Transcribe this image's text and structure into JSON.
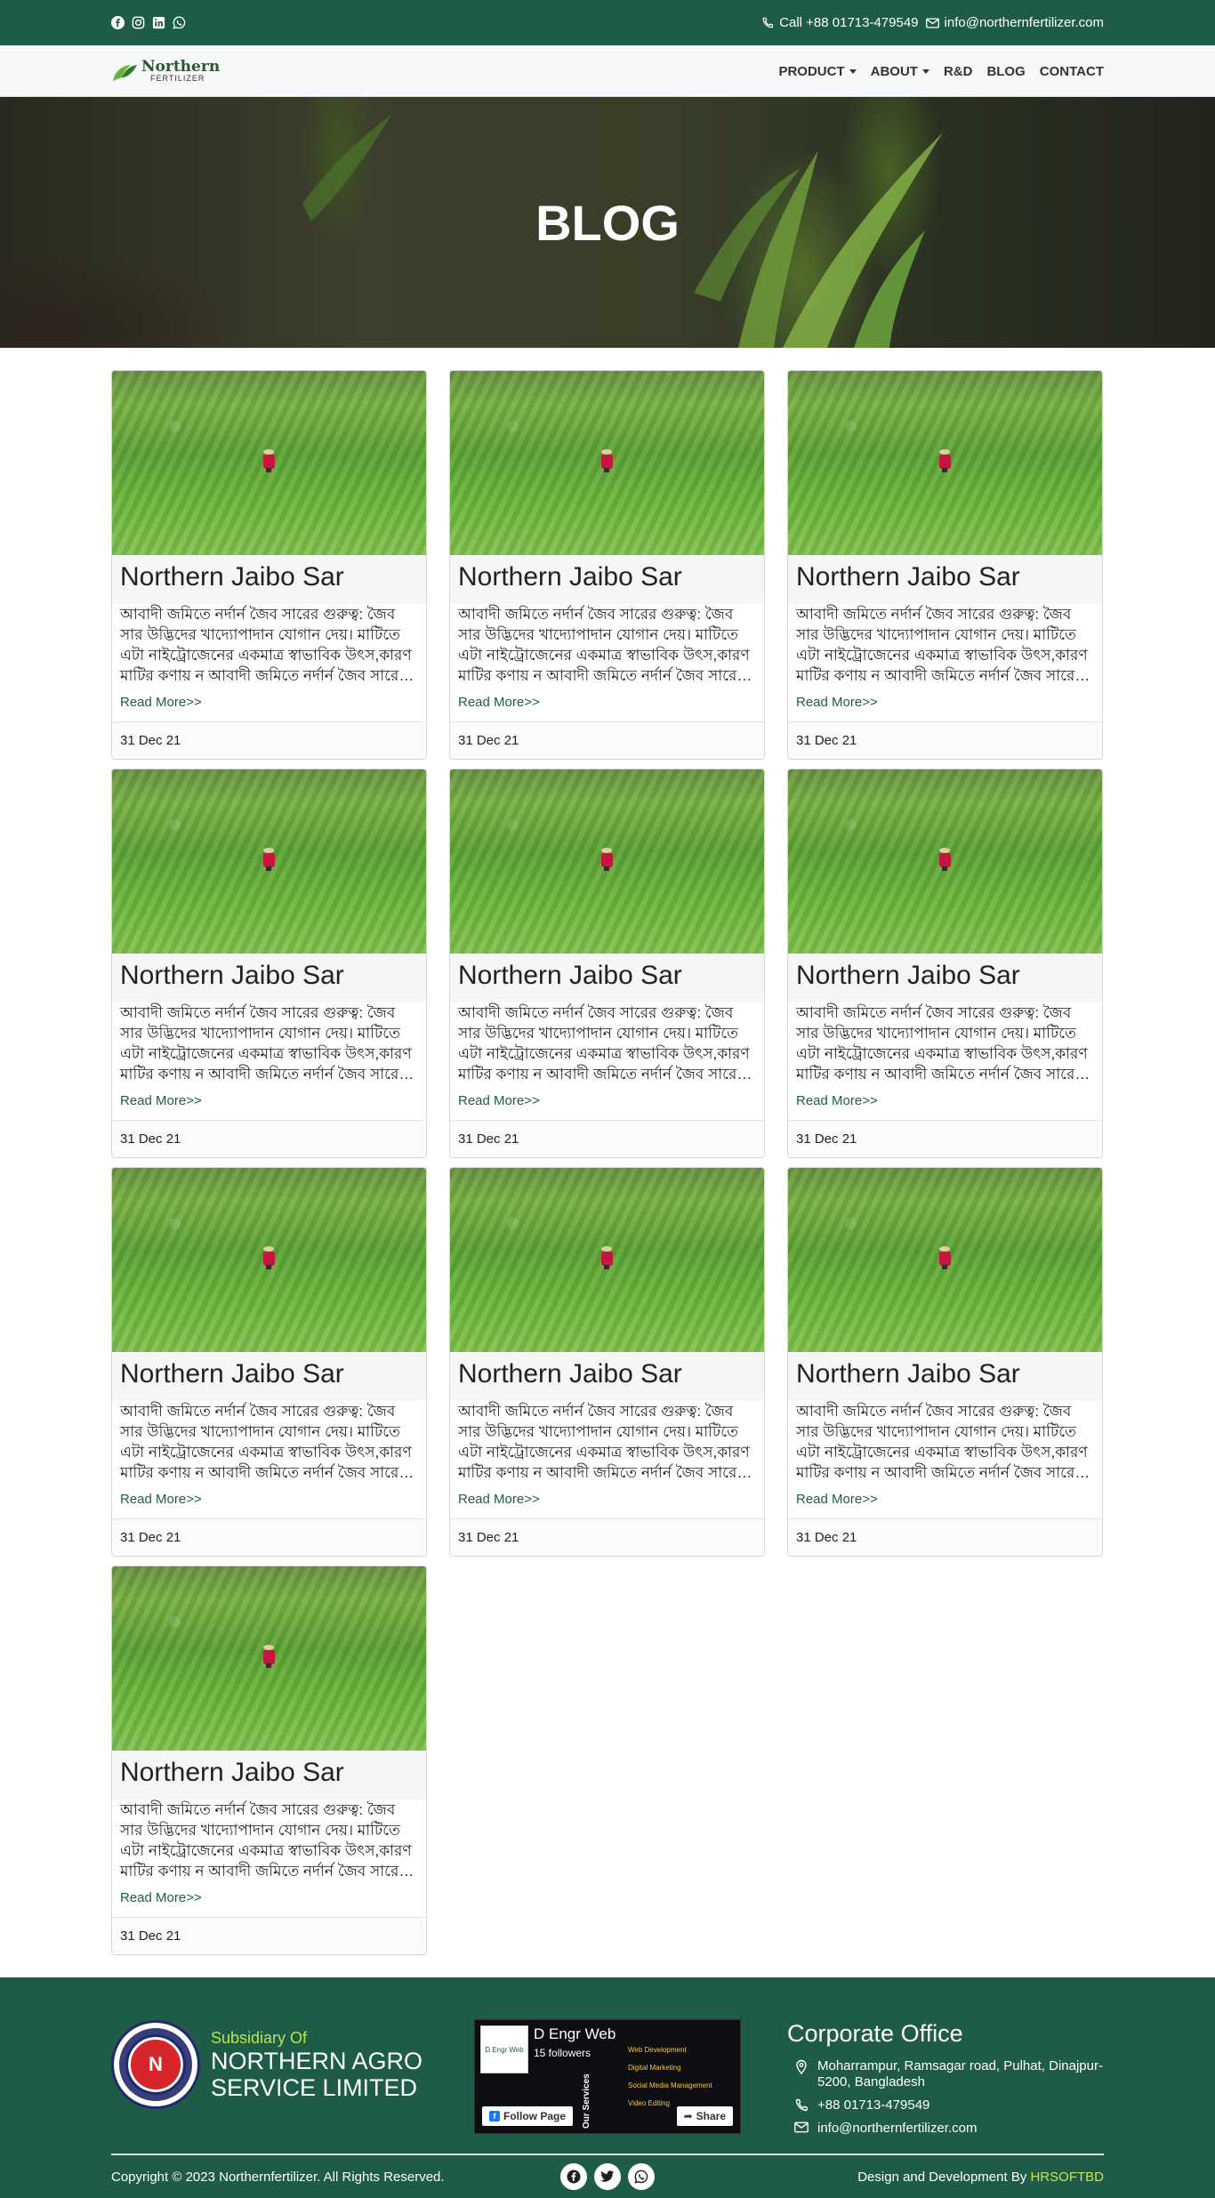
{
  "topbar": {
    "phone": "Call +88 01713-479549",
    "email": "info@northernfertilizer.com",
    "social_icons": [
      "facebook-icon",
      "instagram-icon",
      "linkedin-icon",
      "whatsapp-icon"
    ]
  },
  "nav": {
    "logo_line1": "Northern",
    "logo_line2": "FERTILIZER",
    "items": [
      {
        "label": "PRODUCT",
        "dropdown": true
      },
      {
        "label": "ABOUT",
        "dropdown": true
      },
      {
        "label": "R&D",
        "dropdown": false
      },
      {
        "label": "BLOG",
        "dropdown": false
      },
      {
        "label": "CONTACT",
        "dropdown": false
      }
    ]
  },
  "hero": {
    "title": "BLOG"
  },
  "blog": {
    "posts": [
      {
        "title": "Northern Jaibo Sar",
        "excerpt": "আবাদী জমিতে নর্দার্ন জৈব সারের গুরুত্ব: জৈব সার উদ্ভিদের খাদ্যোপাদান যোগান দেয়। মাটিতে এটা নাইট্রোজেনের একমাত্র স্বাভাবিক উৎস,কারণ মাটির কণায় ন আবাদী জমিতে নর্দার্ন জৈব সারের গুরুত্ব",
        "read_more": "Read More>>",
        "date": "31 Dec 21"
      },
      {
        "title": "Northern Jaibo Sar",
        "excerpt": "আবাদী জমিতে নর্দার্ন জৈব সারের গুরুত্ব: জৈব সার উদ্ভিদের খাদ্যোপাদান যোগান দেয়। মাটিতে এটা নাইট্রোজেনের একমাত্র স্বাভাবিক উৎস,কারণ মাটির কণায় ন আবাদী জমিতে নর্দার্ন জৈব সারের গুরুত্ব",
        "read_more": "Read More>>",
        "date": "31 Dec 21"
      },
      {
        "title": "Northern Jaibo Sar",
        "excerpt": "আবাদী জমিতে নর্দার্ন জৈব সারের গুরুত্ব: জৈব সার উদ্ভিদের খাদ্যোপাদান যোগান দেয়। মাটিতে এটা নাইট্রোজেনের একমাত্র স্বাভাবিক উৎস,কারণ মাটির কণায় ন আবাদী জমিতে নর্দার্ন জৈব সারের গুরুত্ব",
        "read_more": "Read More>>",
        "date": "31 Dec 21"
      },
      {
        "title": "Northern Jaibo Sar",
        "excerpt": "আবাদী জমিতে নর্দার্ন জৈব সারের গুরুত্ব: জৈব সার উদ্ভিদের খাদ্যোপাদান যোগান দেয়। মাটিতে এটা নাইট্রোজেনের একমাত্র স্বাভাবিক উৎস,কারণ মাটির কণায় ন আবাদী জমিতে নর্দার্ন জৈব সারের গুরুত্ব",
        "read_more": "Read More>>",
        "date": "31 Dec 21"
      },
      {
        "title": "Northern Jaibo Sar",
        "excerpt": "আবাদী জমিতে নর্দার্ন জৈব সারের গুরুত্ব: জৈব সার উদ্ভিদের খাদ্যোপাদান যোগান দেয়। মাটিতে এটা নাইট্রোজেনের একমাত্র স্বাভাবিক উৎস,কারণ মাটির কণায় ন আবাদী জমিতে নর্দার্ন জৈব সারের গুরুত্ব",
        "read_more": "Read More>>",
        "date": "31 Dec 21"
      },
      {
        "title": "Northern Jaibo Sar",
        "excerpt": "আবাদী জমিতে নর্দার্ন জৈব সারের গুরুত্ব: জৈব সার উদ্ভিদের খাদ্যোপাদান যোগান দেয়। মাটিতে এটা নাইট্রোজেনের একমাত্র স্বাভাবিক উৎস,কারণ মাটির কণায় ন আবাদী জমিতে নর্দার্ন জৈব সারের গুরুত্ব",
        "read_more": "Read More>>",
        "date": "31 Dec 21"
      },
      {
        "title": "Northern Jaibo Sar",
        "excerpt": "আবাদী জমিতে নর্দার্ন জৈব সারের গুরুত্ব: জৈব সার উদ্ভিদের খাদ্যোপাদান যোগান দেয়। মাটিতে এটা নাইট্রোজেনের একমাত্র স্বাভাবিক উৎস,কারণ মাটির কণায় ন আবাদী জমিতে নর্দার্ন জৈব সারের গুরুত্ব",
        "read_more": "Read More>>",
        "date": "31 Dec 21"
      },
      {
        "title": "Northern Jaibo Sar",
        "excerpt": "আবাদী জমিতে নর্দার্ন জৈব সারের গুরুত্ব: জৈব সার উদ্ভিদের খাদ্যোপাদান যোগান দেয়। মাটিতে এটা নাইট্রোজেনের একমাত্র স্বাভাবিক উৎস,কারণ মাটির কণায় ন আবাদী জমিতে নর্দার্ন জৈব সারের গুরুত্ব",
        "read_more": "Read More>>",
        "date": "31 Dec 21"
      },
      {
        "title": "Northern Jaibo Sar",
        "excerpt": "আবাদী জমিতে নর্দার্ন জৈব সারের গুরুত্ব: জৈব সার উদ্ভিদের খাদ্যোপাদান যোগান দেয়। মাটিতে এটা নাইট্রোজেনের একমাত্র স্বাভাবিক উৎস,কারণ মাটির কণায় ন আবাদী জমিতে নর্দার্ন জৈব সারের গুরুত্ব",
        "read_more": "Read More>>",
        "date": "31 Dec 21"
      },
      {
        "title": "Northern Jaibo Sar",
        "excerpt": "আবাদী জমিতে নর্দার্ন জৈব সারের গুরুত্ব: জৈব সার উদ্ভিদের খাদ্যোপাদান যোগান দেয়। মাটিতে এটা নাইট্রোজেনের একমাত্র স্বাভাবিক উৎস,কারণ মাটির কণায় ন আবাদী জমিতে নর্দার্ন জৈব সারের গুরুত্ব",
        "read_more": "Read More>>",
        "date": "31 Dec 21"
      }
    ]
  },
  "footer": {
    "subsidiary_of": "Subsidiary Of",
    "company_line1": "NORTHERN AGRO",
    "company_line2": "SERVICE LIMITED",
    "seal_text": "NORTHERN AGRO SERVICES LTD",
    "fb": {
      "page_name": "D Engr Web",
      "followers": "15 followers",
      "services": [
        "Web Development",
        "Digital Marketing",
        "Social Media Management",
        "Video Editing"
      ],
      "services_title": "Our Services",
      "follow_label": "Follow Page",
      "share_label": "Share"
    },
    "corporate": {
      "title": "Corporate Office",
      "address": "Moharrampur, Ramsagar road, Pulhat, Dinajpur-5200, Bangladesh",
      "phone": "+88 01713-479549",
      "email": "info@northernfertilizer.com"
    },
    "copyright": "Copyright © 2023 Northernfertilizer. All Rights Reserved.",
    "social_icons": [
      "facebook-icon",
      "twitter-icon",
      "whatsapp-icon"
    ],
    "credit_prefix": "Design and Development By",
    "credit_name": "HRSOFTBD",
    "colors": {
      "primary": "#1f5c47",
      "accent": "#c5e35a"
    }
  }
}
